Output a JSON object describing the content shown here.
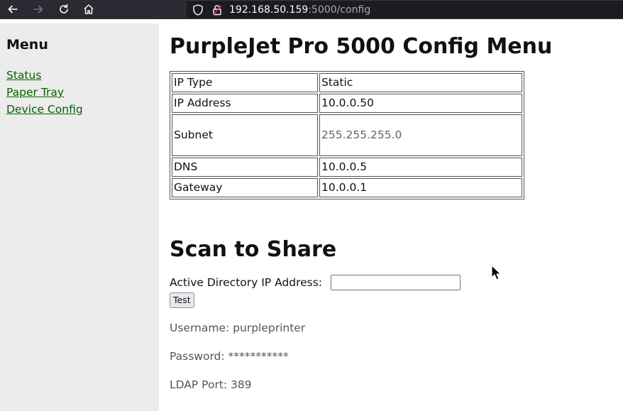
{
  "browser": {
    "url_host": "192.168.50.159",
    "url_path": ":5000/config"
  },
  "sidebar": {
    "heading": "Menu",
    "items": [
      {
        "label": "Status"
      },
      {
        "label": "Paper Tray"
      },
      {
        "label": "Device Config"
      }
    ]
  },
  "main": {
    "title": "PurpleJet Pro 5000 Config Menu",
    "config_table": [
      {
        "key": "IP Type",
        "value": "Static"
      },
      {
        "key": "IP Address",
        "value": "10.0.0.50"
      },
      {
        "key": "Subnet",
        "value": "255.255.255.0"
      },
      {
        "key": "DNS",
        "value": "10.0.0.5"
      },
      {
        "key": "Gateway",
        "value": "10.0.0.1"
      }
    ],
    "scan_section": {
      "title": "Scan to Share",
      "ad_label": "Active Directory IP Address:",
      "ad_value": "",
      "test_label": "Test",
      "username": "Username: purpleprinter",
      "password": "Password: ***********",
      "ldap_port": "LDAP Port: 389"
    }
  },
  "colors": {
    "link": "#006400",
    "sidebar_bg": "#ececec",
    "toolbar_bg": "#2b2a33"
  }
}
